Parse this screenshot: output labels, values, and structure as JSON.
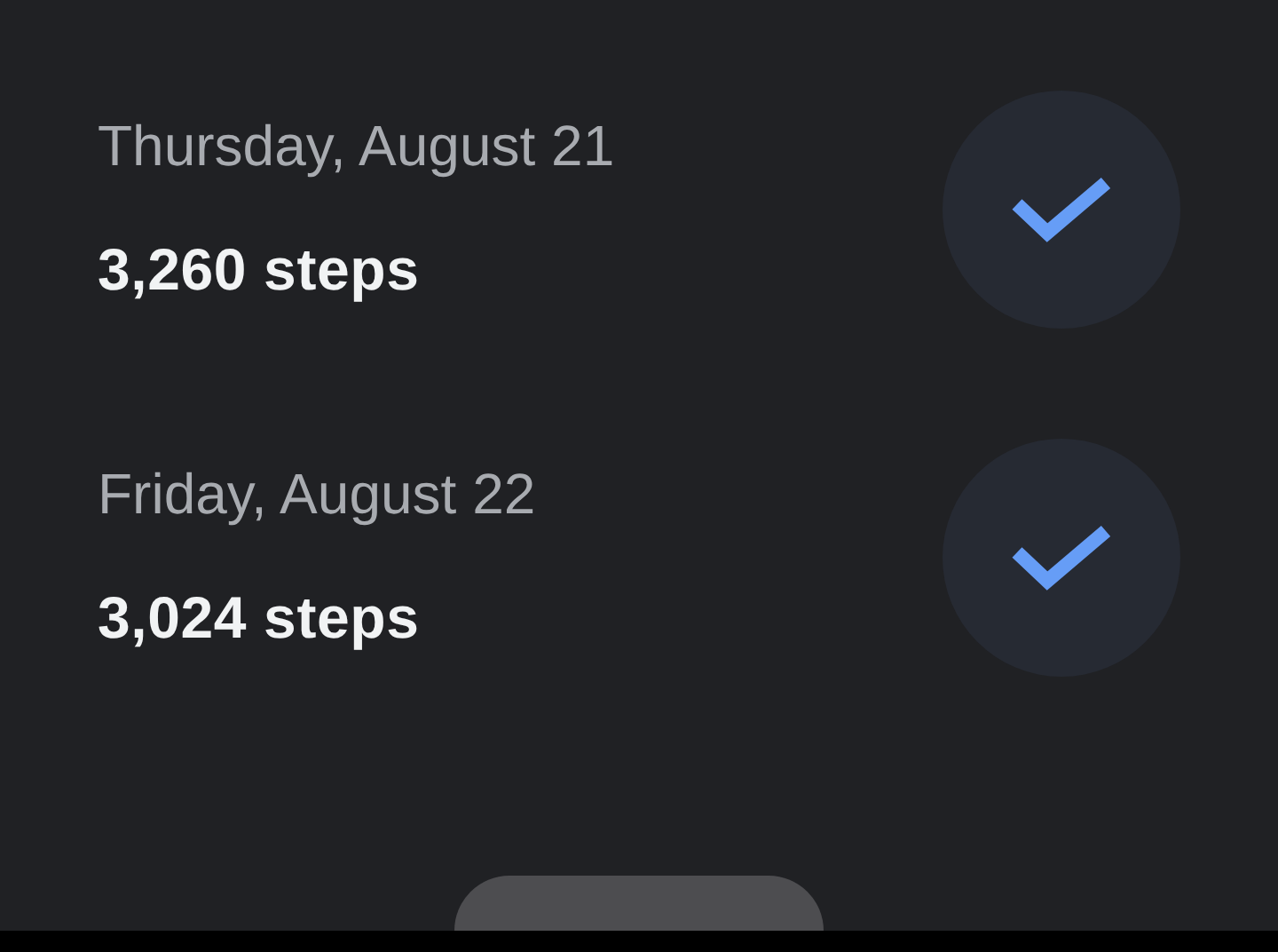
{
  "days": [
    {
      "date": "Thursday, August 21",
      "steps": "3,260 steps",
      "done": true
    },
    {
      "date": "Friday, August 22",
      "steps": "3,024 steps",
      "done": true
    }
  ]
}
